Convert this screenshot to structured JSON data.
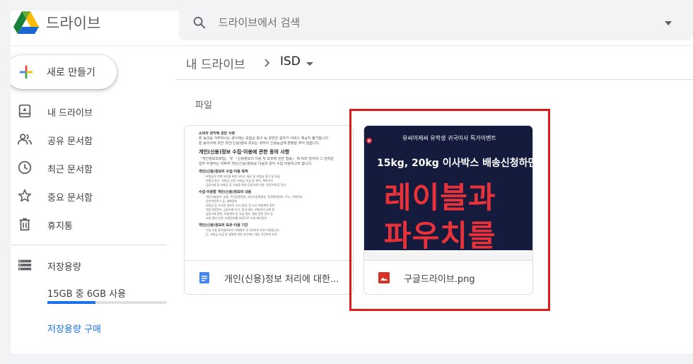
{
  "header": {
    "app_name": "드라이브",
    "search_placeholder": "드라이브에서 검색"
  },
  "sidebar": {
    "new_button": "새로 만들기",
    "items": [
      {
        "label": "내 드라이브",
        "icon": "my-drive-icon"
      },
      {
        "label": "공유 문서함",
        "icon": "shared-icon"
      },
      {
        "label": "최근 문서함",
        "icon": "clock-icon"
      },
      {
        "label": "중요 문서함",
        "icon": "star-icon"
      },
      {
        "label": "휴지통",
        "icon": "trash-icon"
      }
    ],
    "storage": {
      "label": "저장용량",
      "usage_text": "15GB 중 6GB 사용",
      "used_fraction": 0.4,
      "buy_link": "저장용량 구매"
    }
  },
  "breadcrumb": {
    "root": "내 드라이브",
    "current": "ISD"
  },
  "main": {
    "section_label": "파일",
    "files": [
      {
        "name": "개인(신용)정보 처리에 대한...",
        "type": "doc",
        "thumb": {
          "line1": "소비자 권익에 관한 사항",
          "line2": "본 동의를 거부하시는 경우에는 보험금 청구 등 관련한 절차가 서비스 제공이 불가합니다.",
          "line3": "본 동의서에 의한 개인(신용)정보 조회는 귀하의 신용등급에 영향을 주지 않습니다.",
          "heading": "개인(신용)정보 수집·이용에 관한 동의 사항",
          "line4": "「개인정보보호법」 및 「신용정보의 이용 및 보호에 관한 법률」 에 따라 당사와 그 임직원",
          "line5": "업무 수행하는 위탁자 개인(신용)정보를 다음과 같이 수집·이용하고자 합니다.",
          "sub1": "개인(신용)정보의 수집·이용 목적",
          "b1": "보험금의 이행 보장을 위한 서비스 제공 및 보험금 청구 및 지급",
          "b2": "보험금 청구, 보험금 산정, 보험금 지급 등 관리, 계약유지",
          "b3": "금융거래 및 보험금 등 수납을 위한 금융거래 신청, 자동이체 등 정산",
          "sub2": "수집·이용할 개인(신용)정보의 내용",
          "b4": "개인식별정보: 성명, 주민등록번호, 외국인등록번호, 운전면허번호, 주소, 전화번호",
          "b5": "전자우편주소 등, 재화정보",
          "b6": "보험금 등 조사한 정보의 조사 결과, 전 소유 보험계약 정보",
          "b7": "개인신용정보: 금융거래 조건, 동의 여부, 보험료의 상태 등",
          "b8": "금융거래 관련, 보험계약 및 지급 정보, 질병 관련 정보 등",
          "b9": "조회 결과 반영, 보험정보를 바탕으로 조회 재인정보",
          "sub3": "개인(신용)정보의 보유·이용 기간",
          "b10": "수집·이용 동의일로부터 거래종료 후 5년까지 보유·이용됩니다.",
          "b11": "단, 보험금 지급 등 법령에 의한 경우에는 해당 기간까지 보유"
        }
      },
      {
        "name": "구글드라이브.png",
        "type": "image",
        "thumb": {
          "top_text": "유씨어제씨 유학생 귀국이사 특가이벤트",
          "sub_text": "15kg, 20kg 이사박스 배송신청하면",
          "big1": "레이블과",
          "big2": "파우치를"
        }
      }
    ]
  },
  "colors": {
    "accent": "#1a73e8",
    "highlight": "#e01b1b",
    "doc_icon": "#4285f4",
    "image_icon": "#d93025",
    "thumb_bg": "#141b3d",
    "thumb_red": "#e7323a"
  }
}
